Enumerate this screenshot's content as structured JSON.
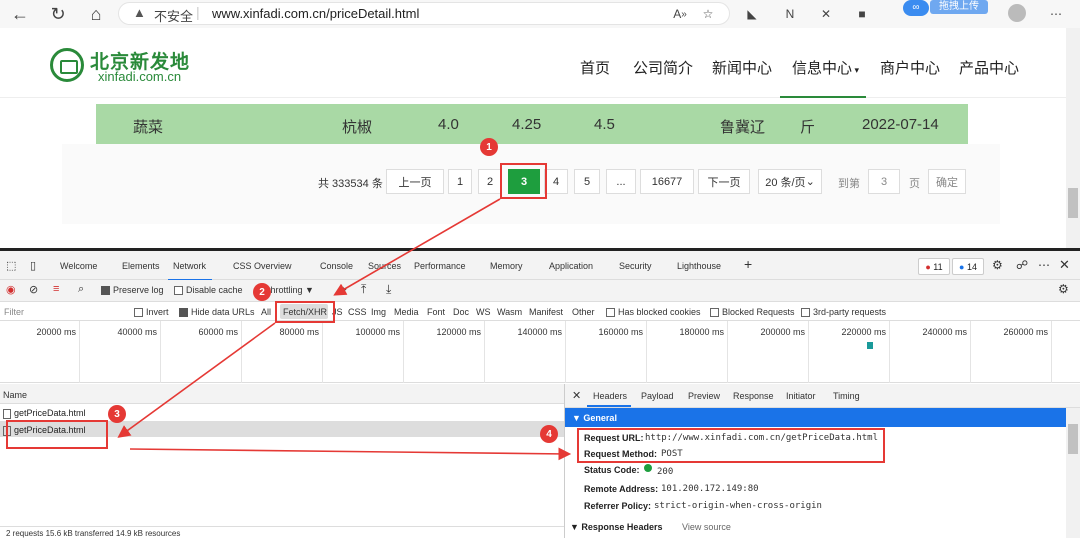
{
  "browser": {
    "security_label": "不安全",
    "url": "www.xinfadi.com.cn/priceDetail.html",
    "upload_label": "拖拽上传"
  },
  "site": {
    "logo_cn": "北京新发地",
    "logo_en": "xinfadi.com.cn",
    "nav": [
      "首页",
      "公司简介",
      "新闻中心",
      "信息中心",
      "商户中心",
      "产品中心"
    ],
    "nav_active": "信息中心"
  },
  "price_row": {
    "category": "蔬菜",
    "product": "杭椒",
    "low": "4.0",
    "avg": "4.25",
    "high": "4.5",
    "origin": "鲁冀辽",
    "unit": "斤",
    "date": "2022-07-14"
  },
  "pagination": {
    "total": "共 333534 条",
    "prev": "上一页",
    "pages": [
      "1",
      "2",
      "3",
      "4",
      "5",
      "...",
      "16677"
    ],
    "current": "3",
    "next": "下一页",
    "page_size": "20 条/页",
    "goto_label": "到第",
    "goto_value": "3",
    "page_label": "页",
    "confirm": "确定"
  },
  "devtools": {
    "tabs": [
      "Welcome",
      "Elements",
      "Network",
      "CSS Overview",
      "Console",
      "Sources",
      "Performance",
      "Memory",
      "Application",
      "Security",
      "Lighthouse"
    ],
    "active_tab": "Network",
    "errors": "11",
    "messages": "14",
    "toolbar": {
      "preserve_log": "Preserve log",
      "disable_cache": "Disable cache",
      "throttling": "throttling"
    },
    "filter": {
      "placeholder": "Filter",
      "invert": "Invert",
      "hide_data_urls": "Hide data URLs",
      "types": [
        "All",
        "Fetch/XHR",
        "JS",
        "CSS",
        "Img",
        "Media",
        "Font",
        "Doc",
        "WS",
        "Wasm",
        "Manifest",
        "Other"
      ],
      "active_type": "Fetch/XHR",
      "blocked_cookies": "Has blocked cookies",
      "blocked_requests": "Blocked Requests",
      "third_party": "3rd-party requests"
    },
    "timeline_ticks": [
      "20000 ms",
      "40000 ms",
      "60000 ms",
      "80000 ms",
      "100000 ms",
      "120000 ms",
      "140000 ms",
      "160000 ms",
      "180000 ms",
      "200000 ms",
      "220000 ms",
      "240000 ms",
      "260000 ms"
    ],
    "name_col": "Name",
    "requests": [
      "getPriceData.html",
      "getPriceData.html"
    ],
    "status": "2 requests  15.6 kB transferred  14.9 kB resources",
    "detail_tabs": [
      "Headers",
      "Payload",
      "Preview",
      "Response",
      "Initiator",
      "Timing"
    ],
    "active_detail": "Headers",
    "general_label": "General",
    "general": [
      {
        "k": "Request URL:",
        "v": "http://www.xinfadi.com.cn/getPriceData.html"
      },
      {
        "k": "Request Method:",
        "v": "POST"
      },
      {
        "k": "Status Code:",
        "v": "200"
      },
      {
        "k": "Remote Address:",
        "v": "101.200.172.149:80"
      },
      {
        "k": "Referrer Policy:",
        "v": "strict-origin-when-cross-origin"
      }
    ],
    "response_headers": "Response Headers",
    "view_source": "View source"
  },
  "annotations": [
    "1",
    "2",
    "3",
    "4"
  ]
}
